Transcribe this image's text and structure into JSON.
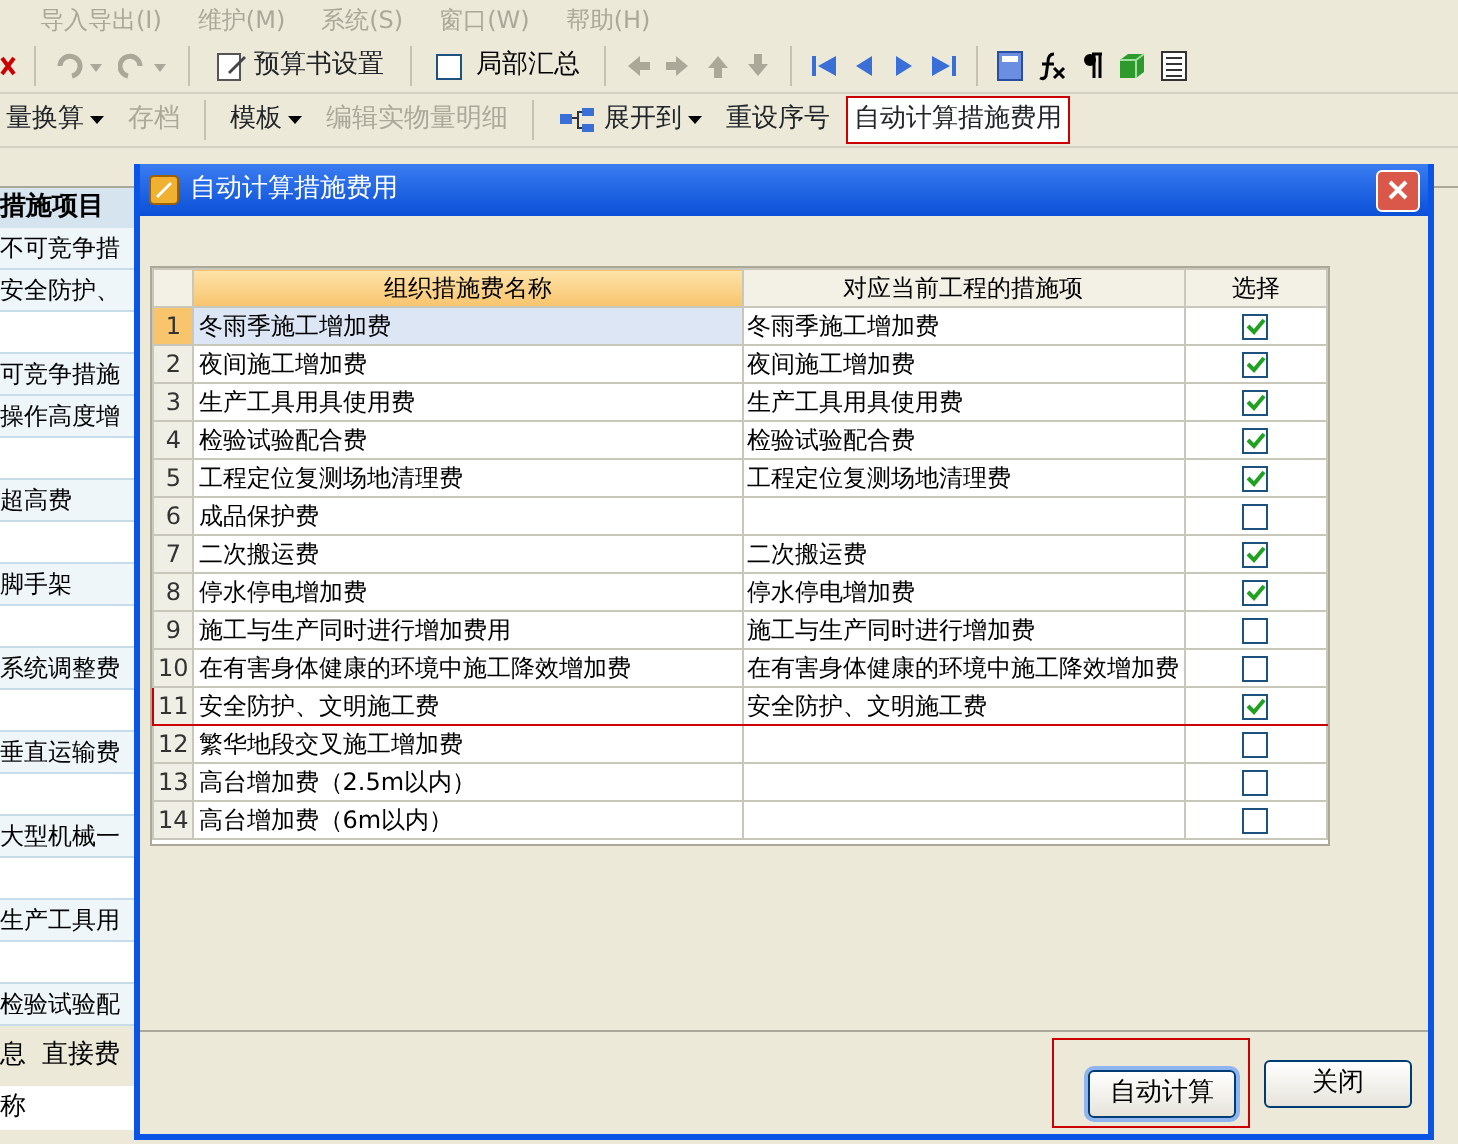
{
  "menu": [
    {
      "label": "导入导出(I)"
    },
    {
      "label": "维护(M)"
    },
    {
      "label": "系统(S)"
    },
    {
      "label": "窗口(W)"
    },
    {
      "label": "帮助(H)"
    }
  ],
  "toolbar1": {
    "settings_button": "预算书设置",
    "summary_checkbox": {
      "label": "局部汇总",
      "checked": false
    }
  },
  "toolbar2": [
    {
      "label": "量换算",
      "kind": "dropdown",
      "disabled": false,
      "highlighted": false
    },
    {
      "label": "存档",
      "kind": "button",
      "disabled": true,
      "highlighted": false
    },
    {
      "label": "模板",
      "kind": "dropdown",
      "disabled": false,
      "highlighted": false
    },
    {
      "label": "编辑实物量明细",
      "kind": "button",
      "disabled": true,
      "highlighted": false
    },
    {
      "label": "展开到",
      "kind": "expand",
      "disabled": false,
      "highlighted": false
    },
    {
      "label": "重设序号",
      "kind": "button",
      "disabled": false,
      "highlighted": false
    },
    {
      "label": "自动计算措施费用",
      "kind": "button",
      "disabled": false,
      "highlighted": true
    }
  ],
  "background_list": {
    "header": "措施项目",
    "items": [
      {
        "label": "不可竞争措",
        "kind": "item"
      },
      {
        "label": "安全防护、",
        "kind": "item"
      },
      {
        "kind": "blank"
      },
      {
        "label": "可竞争措施",
        "kind": "item"
      },
      {
        "label": "操作高度增",
        "kind": "item"
      },
      {
        "kind": "blank"
      },
      {
        "label": "超高费",
        "kind": "item"
      },
      {
        "kind": "blank"
      },
      {
        "label": "脚手架",
        "kind": "item"
      },
      {
        "kind": "blank"
      },
      {
        "label": "系统调整费",
        "kind": "item"
      },
      {
        "kind": "blank"
      },
      {
        "label": "垂直运输费",
        "kind": "item"
      },
      {
        "kind": "blank"
      },
      {
        "label": "大型机械一",
        "kind": "item"
      },
      {
        "kind": "blank"
      },
      {
        "label": "生产工具用",
        "kind": "item"
      },
      {
        "kind": "blank"
      },
      {
        "label": "检验试验配",
        "kind": "item"
      }
    ]
  },
  "bottom_tabs": [
    "息",
    "直接费"
  ],
  "bottom_label": "称",
  "dialog": {
    "title": "自动计算措施费用",
    "columns": [
      "组织措施费名称",
      "对应当前工程的措施项",
      "选择"
    ],
    "rows": [
      {
        "no": "1",
        "name": "冬雨季施工增加费",
        "item": "冬雨季施工增加费",
        "checked": true,
        "selected": true,
        "highlighted": false
      },
      {
        "no": "2",
        "name": "夜间施工增加费",
        "item": "夜间施工增加费",
        "checked": true,
        "selected": false,
        "highlighted": false
      },
      {
        "no": "3",
        "name": "生产工具用具使用费",
        "item": "生产工具用具使用费",
        "checked": true,
        "selected": false,
        "highlighted": false
      },
      {
        "no": "4",
        "name": "检验试验配合费",
        "item": "检验试验配合费",
        "checked": true,
        "selected": false,
        "highlighted": false
      },
      {
        "no": "5",
        "name": "工程定位复测场地清理费",
        "item": "工程定位复测场地清理费",
        "checked": true,
        "selected": false,
        "highlighted": false
      },
      {
        "no": "6",
        "name": "成品保护费",
        "item": "",
        "checked": false,
        "selected": false,
        "highlighted": false
      },
      {
        "no": "7",
        "name": "二次搬运费",
        "item": "二次搬运费",
        "checked": true,
        "selected": false,
        "highlighted": false
      },
      {
        "no": "8",
        "name": "停水停电增加费",
        "item": "停水停电增加费",
        "checked": true,
        "selected": false,
        "highlighted": false
      },
      {
        "no": "9",
        "name": "施工与生产同时进行增加费用",
        "item": "施工与生产同时进行增加费",
        "checked": false,
        "selected": false,
        "highlighted": false
      },
      {
        "no": "10",
        "name": "在有害身体健康的环境中施工降效增加费",
        "item": "在有害身体健康的环境中施工降效增加费",
        "checked": false,
        "selected": false,
        "highlighted": false
      },
      {
        "no": "11",
        "name": "安全防护、文明施工费",
        "item": "安全防护、文明施工费",
        "checked": true,
        "selected": false,
        "highlighted": true
      },
      {
        "no": "12",
        "name": "繁华地段交叉施工增加费",
        "item": "",
        "checked": false,
        "selected": false,
        "highlighted": false
      },
      {
        "no": "13",
        "name": "高台增加费（2.5m以内）",
        "item": "",
        "checked": false,
        "selected": false,
        "highlighted": false
      },
      {
        "no": "14",
        "name": "高台增加费（6m以内）",
        "item": "",
        "checked": false,
        "selected": false,
        "highlighted": false
      }
    ],
    "buttons": [
      {
        "label": "自动计算",
        "highlighted": true
      },
      {
        "label": "关闭",
        "highlighted": false
      }
    ]
  }
}
